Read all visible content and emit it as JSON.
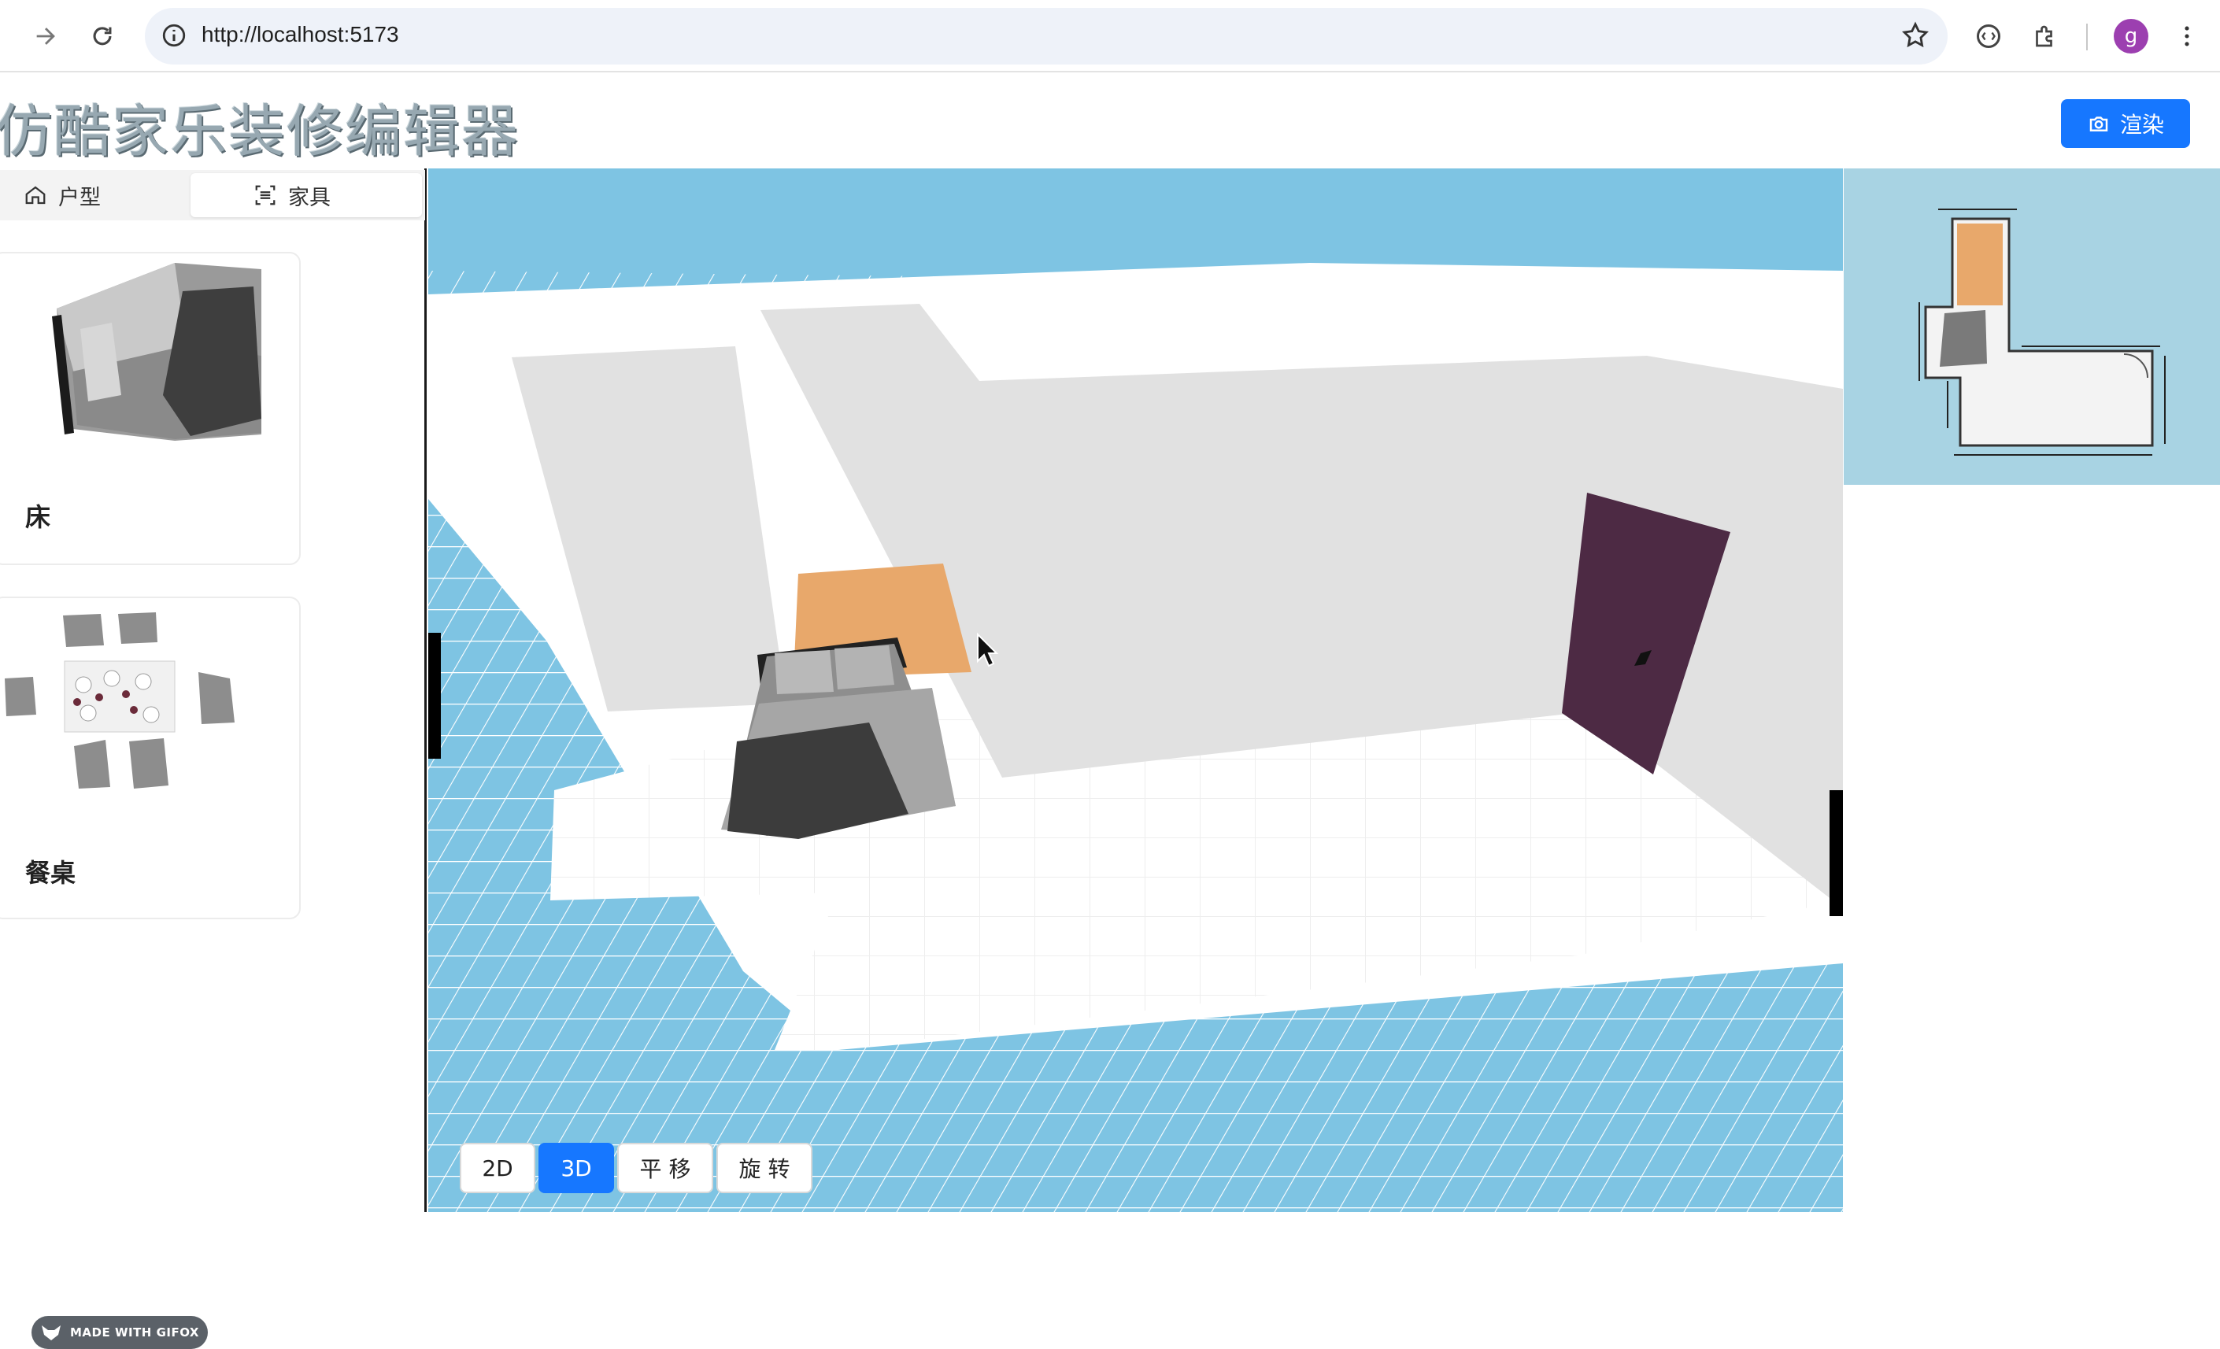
{
  "browser": {
    "url": "http://localhost:5173",
    "avatar_letter": "g"
  },
  "header": {
    "title": "仿酷家乐装修编辑器",
    "render_label": "渲染"
  },
  "sidebar": {
    "tabs": [
      {
        "label": "户型",
        "icon": "home-icon",
        "active": false
      },
      {
        "label": "家具",
        "icon": "scan-icon",
        "active": true
      }
    ],
    "items": [
      {
        "label": "床",
        "icon": "bed-thumbnail"
      },
      {
        "label": "餐桌",
        "icon": "dining-table-thumbnail"
      }
    ]
  },
  "view_controls": {
    "buttons": [
      {
        "label": "2D",
        "active": false
      },
      {
        "label": "3D",
        "active": true
      },
      {
        "label": "平 移",
        "active": false
      },
      {
        "label": "旋 转",
        "active": false
      }
    ]
  },
  "watermark": "MADE WITH GIFOX",
  "colors": {
    "accent": "#1677ff",
    "sky": "#7ec4e3",
    "wall": "#e1e1e1",
    "floor": "#ffffff",
    "door": "#4d2a44",
    "rug": "#e8a86b"
  }
}
